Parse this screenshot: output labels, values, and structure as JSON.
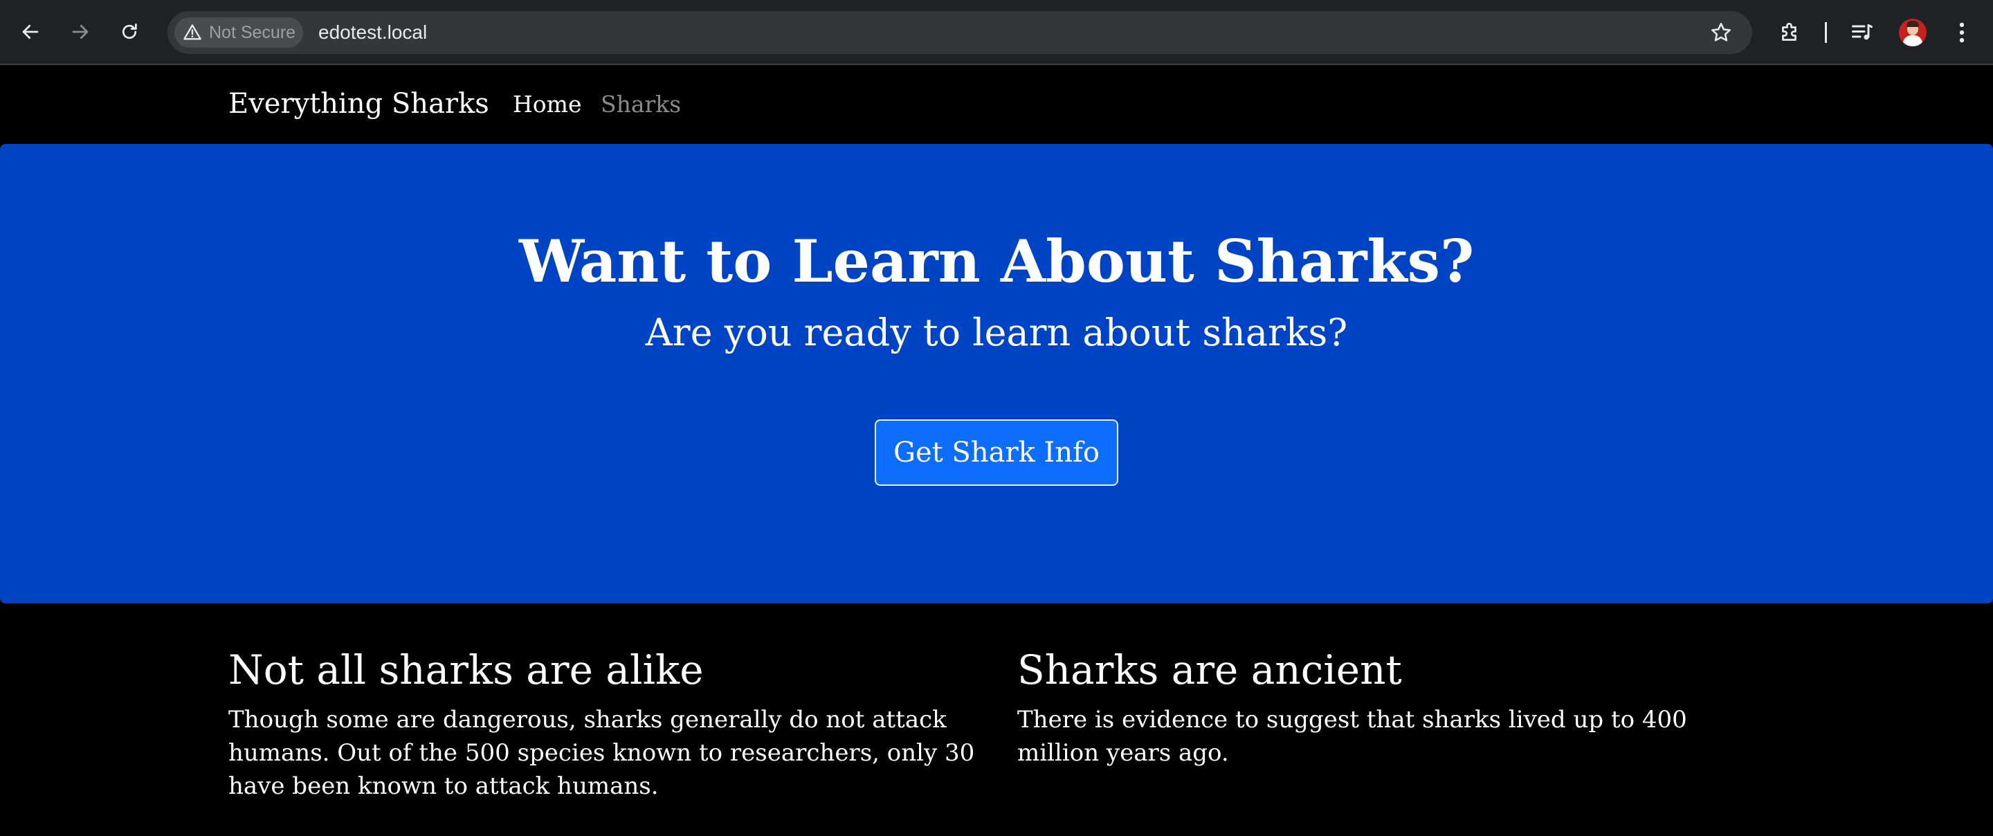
{
  "browser": {
    "security_label": "Not Secure",
    "url": "edotest.local"
  },
  "site": {
    "brand": "Everything Sharks",
    "nav": {
      "home": "Home",
      "sharks": "Sharks"
    }
  },
  "hero": {
    "title": "Want to Learn About Sharks?",
    "subtitle": "Are you ready to learn about sharks?",
    "button_label": "Get Shark Info",
    "background_color": "#0044c6",
    "button_color": "#0d6efd"
  },
  "columns": [
    {
      "heading": "Not all sharks are alike",
      "body": "Though some are dangerous, sharks generally do not attack humans. Out of the 500 species known to researchers, only 30 have been known to attack humans."
    },
    {
      "heading": "Sharks are ancient",
      "body": "There is evidence to suggest that sharks lived up to 400 million years ago."
    }
  ],
  "icons": {
    "back": "arrow-left-icon",
    "forward": "arrow-right-icon",
    "reload": "reload-icon",
    "warning": "warning-triangle-icon",
    "bookmark": "star-icon",
    "extensions": "puzzle-icon",
    "media": "media-queue-icon",
    "menu": "kebab-menu-icon"
  }
}
